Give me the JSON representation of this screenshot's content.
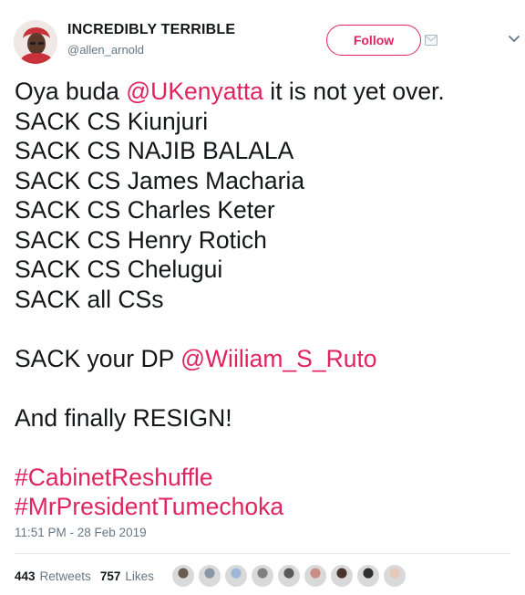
{
  "author": {
    "display_name": "INCREDIBLY TERRIBLE",
    "handle": "@allen_arnold"
  },
  "follow_button_label": "Follow",
  "tweet": {
    "line1_prefix": "Oya buda ",
    "line1_mention": "@UKenyatta",
    "line1_suffix": " it is not yet over.",
    "sack_lines": [
      "SACK CS Kiunjuri",
      "SACK CS NAJIB BALALA",
      "SACK CS James Macharia",
      "SACK CS Charles Keter",
      "SACK CS Henry Rotich",
      "SACK CS Chelugui",
      "SACK all CSs"
    ],
    "dp_prefix": "SACK your DP ",
    "dp_mention": "@Wiiliam_S_Ruto",
    "finally_line": "And finally RESIGN!",
    "hashtags": [
      "#CabinetReshuffle",
      "#MrPresidentTumechoka"
    ]
  },
  "timestamp": "11:51 PM - 28 Feb 2019",
  "stats": {
    "retweets_count": "443",
    "retweets_label": "Retweets",
    "likes_count": "757",
    "likes_label": "Likes"
  },
  "likers": [
    {
      "name": "liker-avatar-1",
      "color": "#6b5a4e"
    },
    {
      "name": "liker-avatar-2",
      "color": "#8a95a5"
    },
    {
      "name": "liker-avatar-3",
      "color": "#9fb7d6"
    },
    {
      "name": "liker-avatar-4",
      "color": "#7f7f7f"
    },
    {
      "name": "liker-avatar-5",
      "color": "#5a5a5a"
    },
    {
      "name": "liker-avatar-6",
      "color": "#c98f86"
    },
    {
      "name": "liker-avatar-7",
      "color": "#4a3328"
    },
    {
      "name": "liker-avatar-8",
      "color": "#2e2e2e"
    },
    {
      "name": "liker-avatar-9",
      "color": "#e6c9b6"
    }
  ],
  "colors": {
    "accent": "#e0245e",
    "text": "#14171a",
    "secondary": "#657786",
    "divider": "#e6ecf0"
  },
  "icons": {
    "avatar": "profile-photo",
    "message": "envelope-icon",
    "menu": "chevron-down-icon"
  }
}
